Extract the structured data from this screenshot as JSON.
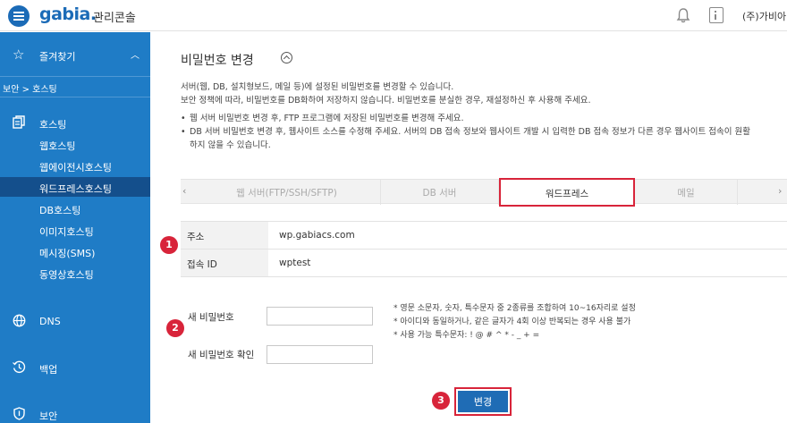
{
  "header": {
    "logo_text": "gabia.",
    "console_title": "관리콘솔",
    "user_name": "(주)가비아"
  },
  "icons": {
    "menu": "hamburger-menu-icon",
    "bell": "bell-icon",
    "info": "info-panel-icon"
  },
  "sidebar": {
    "favorites_label": "즐겨찾기",
    "breadcrumb": "보안 > 호스팅",
    "sections": [
      {
        "label": "호스팅",
        "icon": "copy-icon"
      },
      {
        "label": "DNS",
        "icon": "globe-icon"
      },
      {
        "label": "백업",
        "icon": "history-icon"
      },
      {
        "label": "보안",
        "icon": "shield-icon"
      }
    ],
    "hosting_items": [
      {
        "label": "웹호스팅",
        "active": false
      },
      {
        "label": "웹에이전시호스팅",
        "active": false
      },
      {
        "label": "워드프레스호스팅",
        "active": true
      },
      {
        "label": "DB호스팅",
        "active": false
      },
      {
        "label": "이미지호스팅",
        "active": false
      },
      {
        "label": "메시징(SMS)",
        "active": false
      },
      {
        "label": "동영상호스팅",
        "active": false
      }
    ]
  },
  "main": {
    "title": "비밀번호 변경",
    "desc_line1": "서버(웹, DB, 설치형보드, 메일 등)에 설정된 비밀번호를 변경할 수 있습니다.",
    "desc_line2": "보안 정책에 따라, 비밀번호를 DB화하여 저장하지 않습니다. 비밀번호를 분실한 경우, 재설정하신 후 사용해 주세요.",
    "note1": "웹 서버 비밀번호 변경 후, FTP 프로그램에 저장된 비밀번호를 변경해 주세요.",
    "note2_line1": "DB 서버 비밀번호 변경 후, 웹사이트 소스를 수정해 주세요. 서버의 DB 접속 정보와 웹사이트 개발 시 입력한 DB 접속 정보가 다른 경우 웹사이트 접속이 원활",
    "note2_line2": "하지 않을 수 있습니다.",
    "tabs": [
      {
        "label": "웹 서버(FTP/SSH/SFTP)",
        "selected": false
      },
      {
        "label": "DB 서버",
        "selected": false
      },
      {
        "label": "워드프레스",
        "selected": true
      },
      {
        "label": "메일",
        "selected": false
      }
    ],
    "info": {
      "address_label": "주소",
      "address_value": "wp.gabiacs.com",
      "login_label": "접속 ID",
      "login_value": "wptest"
    },
    "form": {
      "new_pw_label": "새 비밀번호",
      "new_pw_value": "",
      "confirm_pw_label": "새 비밀번호 확인",
      "confirm_pw_value": ""
    },
    "pw_rules": [
      "* 영문 소문자, 숫자, 특수문자 중 2종류를 조합하여 10~16자리로 설정",
      "* 아이디와 동일하거나, 같은 글자가 4회 이상 반복되는 경우 사용 불가",
      "* 사용 가능 특수문자: ! @ # ^ * - _ + ="
    ],
    "submit_label": "변경"
  },
  "badges": [
    "1",
    "2",
    "3"
  ],
  "colors": {
    "sidebar_bg": "#1f7cc6",
    "sidebar_active": "#144f8c",
    "button_bg": "#1f6cb5",
    "highlight_red": "#d8243a"
  }
}
